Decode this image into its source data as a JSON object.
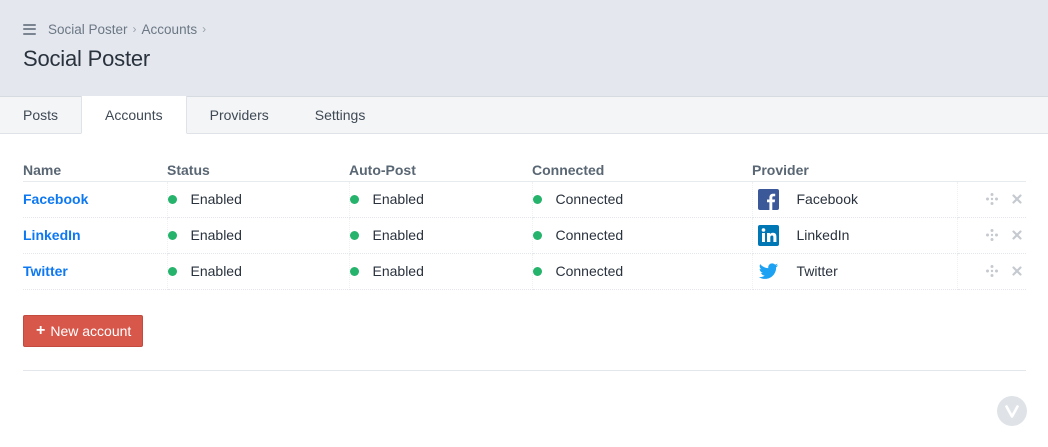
{
  "breadcrumb": {
    "items": [
      "Social Poster",
      "Accounts"
    ],
    "separator": "›"
  },
  "page": {
    "title": "Social Poster"
  },
  "tabs": [
    {
      "label": "Posts",
      "active": false
    },
    {
      "label": "Accounts",
      "active": true
    },
    {
      "label": "Providers",
      "active": false
    },
    {
      "label": "Settings",
      "active": false
    }
  ],
  "table": {
    "headers": [
      "Name",
      "Status",
      "Auto-Post",
      "Connected",
      "Provider"
    ],
    "rows": [
      {
        "name": "Facebook",
        "status": "Enabled",
        "autopost": "Enabled",
        "connected": "Connected",
        "provider": "Facebook",
        "provider_icon": "facebook-icon",
        "provider_color": "#3b5998"
      },
      {
        "name": "LinkedIn",
        "status": "Enabled",
        "autopost": "Enabled",
        "connected": "Connected",
        "provider": "LinkedIn",
        "provider_icon": "linkedin-icon",
        "provider_color": "#0077b5"
      },
      {
        "name": "Twitter",
        "status": "Enabled",
        "autopost": "Enabled",
        "connected": "Connected",
        "provider": "Twitter",
        "provider_icon": "twitter-icon",
        "provider_color": "#1da1f2"
      }
    ]
  },
  "new_account_button": {
    "label": "New account",
    "icon": "plus-icon"
  },
  "colors": {
    "accent_link": "#0d78f2",
    "status_green": "#26b36b",
    "danger_button": "#d7574b",
    "header_bg": "#e4e8ee"
  },
  "badge": {
    "letter": "V"
  }
}
